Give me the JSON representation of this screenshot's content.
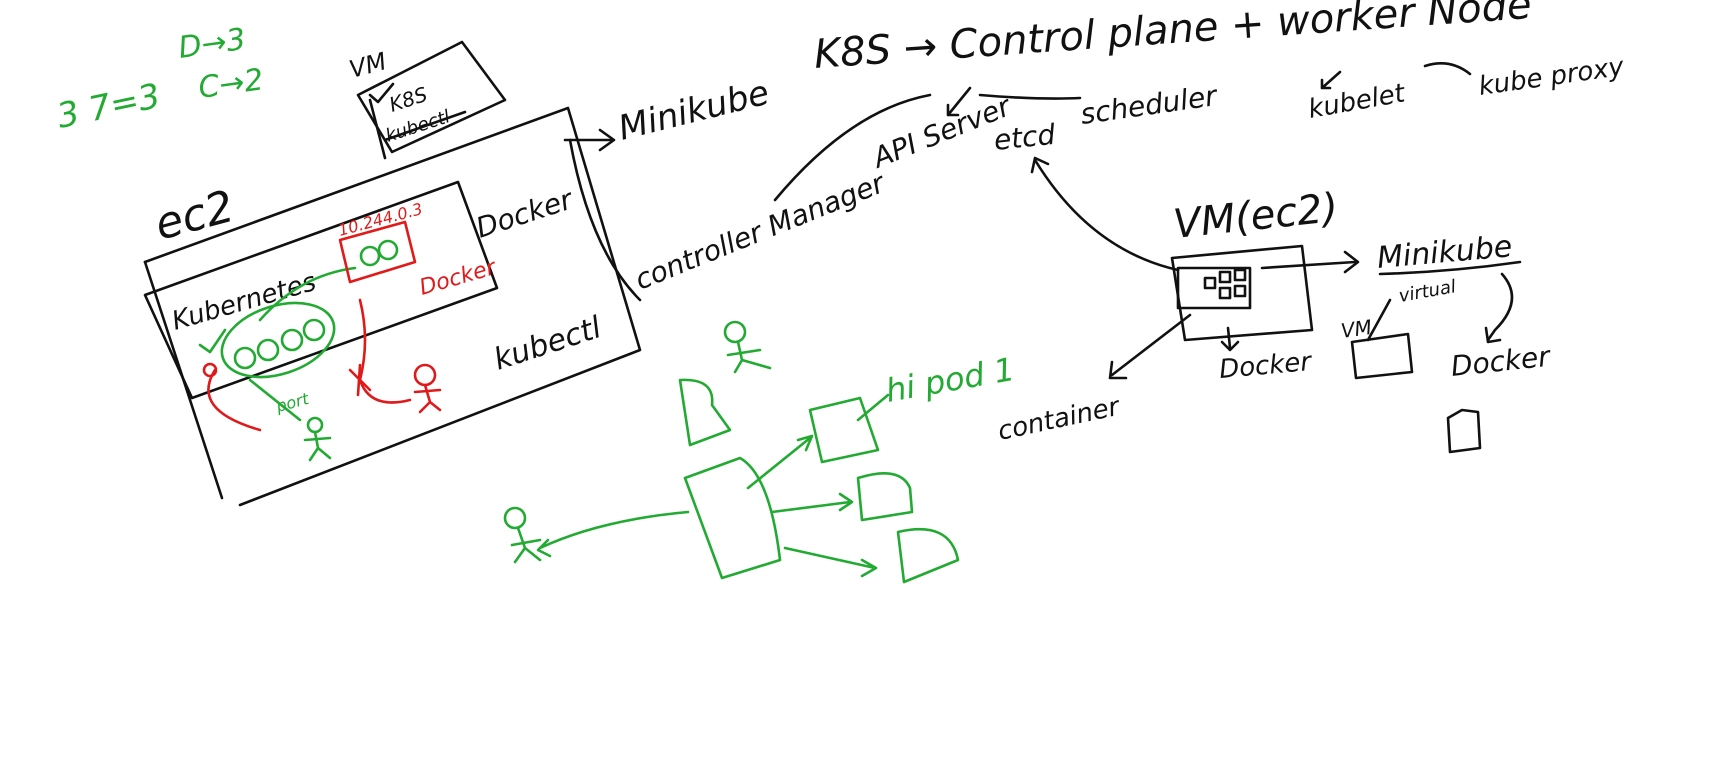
{
  "colors": {
    "black": "#111111",
    "green": "#22aa33",
    "red": "#e01a1a"
  },
  "notes": {
    "math1": "3 7=3",
    "math2a": "D→3",
    "math2b": "C→2",
    "vm_box": "VM",
    "vm_k8s": "K8S",
    "vm_strike": "kubectl",
    "ec2": "ec2",
    "minikube_top": "Minikube",
    "docker_top": "Docker",
    "kubernetes": "Kubernetes",
    "ip": "10.244.0.3",
    "red_docker": "Docker",
    "port": "port",
    "kubectl": "kubectl",
    "k8s_title": "K8S → Control plane + worker Node",
    "kubelet": "kubelet",
    "kube_proxy": "kube proxy",
    "api_server": "API Server",
    "etcd": "etcd",
    "scheduler": "scheduler",
    "controller_manager": "controller Manager",
    "vm_ec2": "VM(ec2)",
    "minikube_right": "Minikube",
    "virtual": "virtual",
    "vm_small": "VM",
    "docker_right": "Docker",
    "docker_under": "Docker",
    "container": "container",
    "hi_pod": "hi pod 1"
  }
}
